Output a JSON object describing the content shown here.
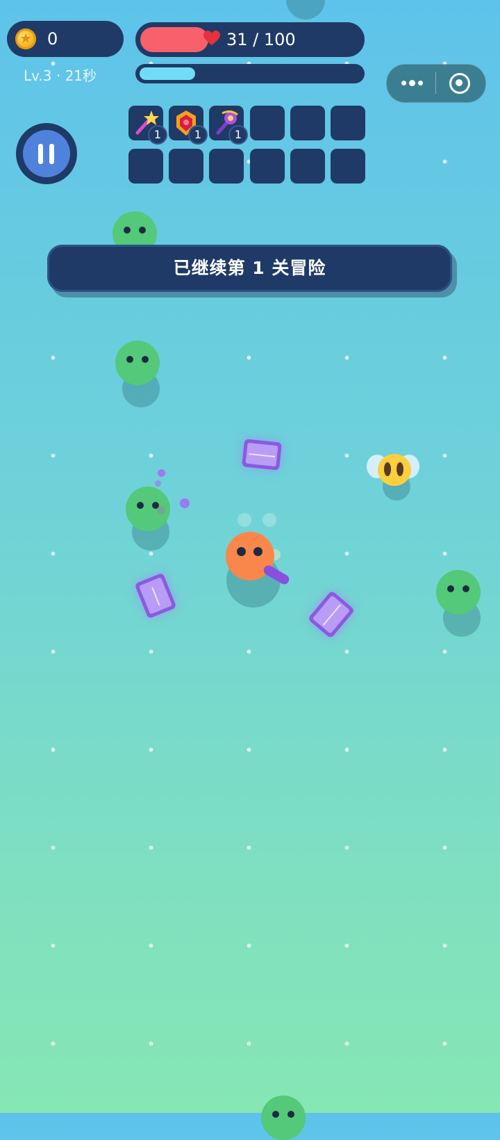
{
  "hud": {
    "coins": "0",
    "level_time": "Lv.3 · 21秒",
    "hp_text": "31 / 100",
    "hp_fraction": 0.31,
    "xp_fraction": 0.25
  },
  "skills": [
    {
      "name": "star-wand-icon",
      "count": "1"
    },
    {
      "name": "ruby-crest-icon",
      "count": "1"
    },
    {
      "name": "purple-orb-staff-icon",
      "count": "1"
    }
  ],
  "banner": {
    "text": "已继续第 1 关冒险"
  },
  "colors": {
    "panel": "#1f3a66",
    "hp": "#f8606c",
    "xp": "#71dcf7",
    "pause": "#4f83db",
    "slime": "#54c979",
    "player": "#f9874c",
    "gem": "#8a5ae0",
    "bee": "#fcd03d"
  }
}
